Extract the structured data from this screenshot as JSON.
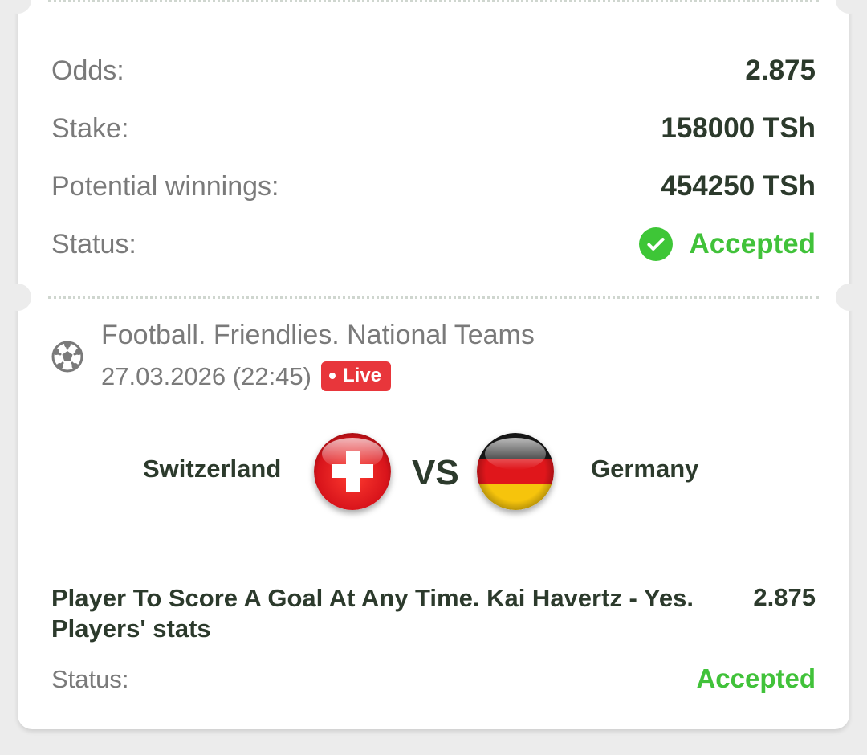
{
  "summary": {
    "odds_label": "Odds:",
    "odds_value": "2.875",
    "stake_label": "Stake:",
    "stake_value": "158000 TSh",
    "winnings_label": "Potential winnings:",
    "winnings_value": "454250 TSh",
    "status_label": "Status:",
    "status_value": "Accepted",
    "status_icon": "check-circle-icon"
  },
  "event": {
    "sport_icon": "soccer-ball-icon",
    "league": "Football. Friendlies. National Teams",
    "datetime": "27.03.2026 (22:45)",
    "live_label": "Live",
    "home_team": "Switzerland",
    "away_team": "Germany",
    "vs_label": "VS",
    "home_flag_icon": "switzerland-flag-icon",
    "away_flag_icon": "germany-flag-icon"
  },
  "selection": {
    "market": "Player To Score A Goal At Any Time. Kai Havertz - Yes. Players' stats",
    "odds": "2.875",
    "status_label": "Status:",
    "status_value": "Accepted"
  },
  "colors": {
    "accepted_green": "#41c23a",
    "live_red": "#e8363b",
    "dark_text": "#2c3a2c",
    "muted_text": "#7a7a7a"
  }
}
